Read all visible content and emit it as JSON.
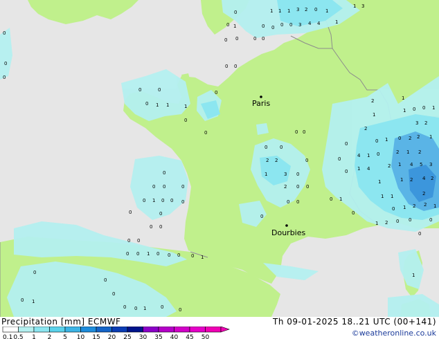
{
  "map": {
    "cities": [
      {
        "name": "Paris"
      },
      {
        "name": "Dourbies"
      }
    ],
    "precip_labels": [
      "0",
      "1",
      "2",
      "3",
      "4",
      "5",
      "6"
    ]
  },
  "footer": {
    "title": "Precipitation [mm]  ECMWF",
    "datetime": "Th 09-01-2025 18..21 UTC (00+141)",
    "credit": "©weatheronline.co.uk"
  },
  "legend": {
    "ticks": [
      "0.1",
      "0.5",
      "1",
      "2",
      "5",
      "10",
      "15",
      "20",
      "25",
      "30",
      "35",
      "40",
      "45",
      "50"
    ],
    "colors": [
      "#ffffff",
      "#b4f0f0",
      "#8ce6f0",
      "#5ad2eb",
      "#3cb4e6",
      "#1e8cdc",
      "#1464c8",
      "#0a3cb4",
      "#00148c",
      "#8c00c8",
      "#b400c8",
      "#d200c8",
      "#e600c8",
      "#f000b4"
    ]
  },
  "colors": {
    "land": "#c0f08c",
    "sea": "#e6e6e6",
    "border": "#8c8c8c",
    "precip_light": "#b4f0f0",
    "precip_mid": "#8ce6f0",
    "precip_heavy": "#5ab4e6"
  }
}
